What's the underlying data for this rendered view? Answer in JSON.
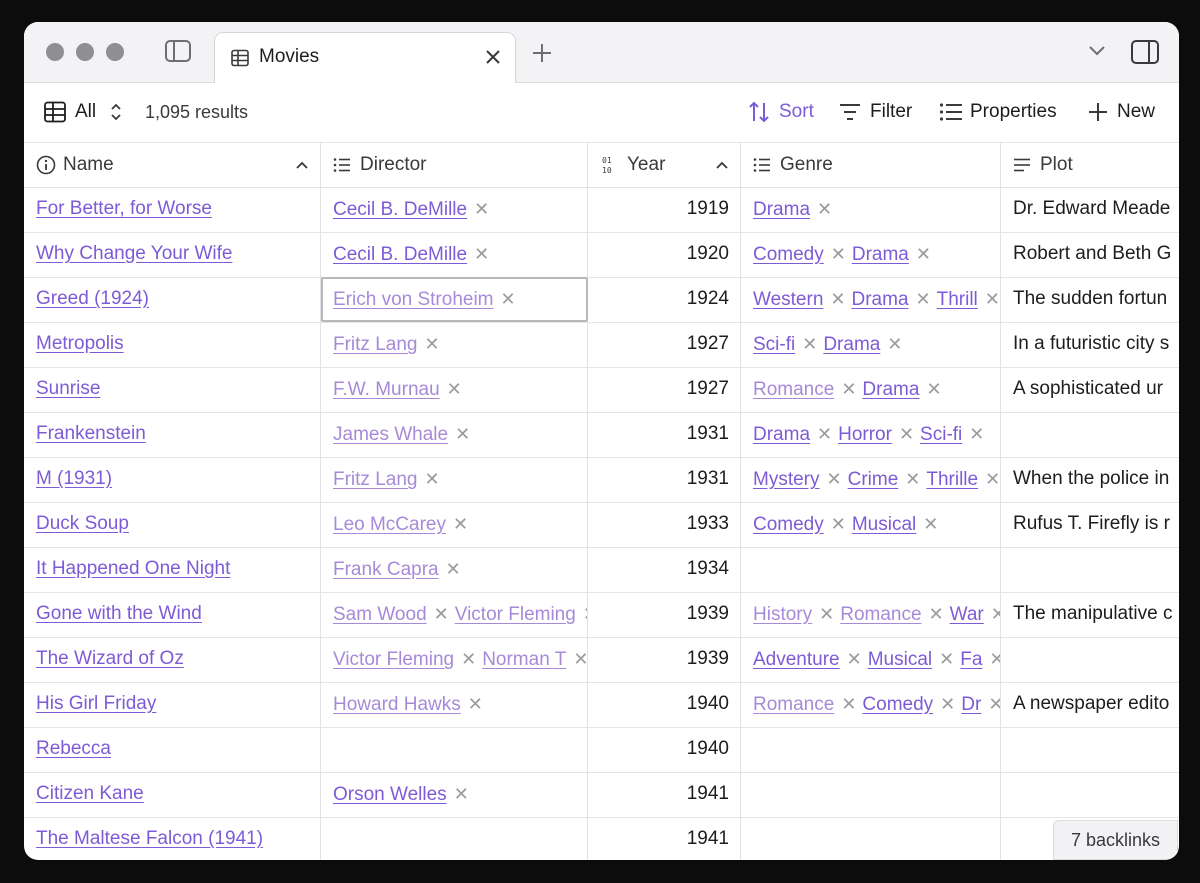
{
  "tab": {
    "title": "Movies"
  },
  "toolbar": {
    "view_label": "All",
    "results": "1,095 results",
    "sort_label": "Sort",
    "filter_label": "Filter",
    "properties_label": "Properties",
    "new_label": "New"
  },
  "columns": {
    "name": "Name",
    "director": "Director",
    "year": "Year",
    "genre": "Genre",
    "plot": "Plot"
  },
  "rows": [
    {
      "name": "For Better, for Worse",
      "directors": [
        {
          "text": "Cecil B. DeMille",
          "style": "link"
        }
      ],
      "year": "1919",
      "genres": [
        {
          "text": "Drama",
          "style": "link"
        }
      ],
      "plot": "Dr. Edward Meade"
    },
    {
      "name": "Why Change Your Wife",
      "directors": [
        {
          "text": "Cecil B. DeMille",
          "style": "link"
        }
      ],
      "year": "1920",
      "genres": [
        {
          "text": "Comedy",
          "style": "link"
        },
        {
          "text": "Drama",
          "style": "link"
        }
      ],
      "plot": "Robert and Beth G"
    },
    {
      "name": "Greed (1924)",
      "directors": [
        {
          "text": "Erich von Stroheim",
          "style": "light"
        }
      ],
      "year": "1924",
      "genres": [
        {
          "text": "Western",
          "style": "link"
        },
        {
          "text": "Drama",
          "style": "link"
        },
        {
          "text": "Thrill",
          "style": "link"
        }
      ],
      "plot": "The sudden fortun"
    },
    {
      "name": "Metropolis",
      "directors": [
        {
          "text": "Fritz Lang",
          "style": "light"
        }
      ],
      "year": "1927",
      "genres": [
        {
          "text": "Sci-fi",
          "style": "link"
        },
        {
          "text": "Drama",
          "style": "link"
        }
      ],
      "plot": "In a futuristic city s"
    },
    {
      "name": "Sunrise",
      "directors": [
        {
          "text": "F.W. Murnau",
          "style": "light"
        }
      ],
      "year": "1927",
      "genres": [
        {
          "text": "Romance",
          "style": "light"
        },
        {
          "text": "Drama",
          "style": "link"
        }
      ],
      "plot": "A sophisticated ur"
    },
    {
      "name": "Frankenstein",
      "directors": [
        {
          "text": "James Whale",
          "style": "light"
        }
      ],
      "year": "1931",
      "genres": [
        {
          "text": "Drama",
          "style": "link"
        },
        {
          "text": "Horror",
          "style": "link"
        },
        {
          "text": "Sci-fi",
          "style": "link"
        }
      ],
      "plot": ""
    },
    {
      "name": "M (1931)",
      "directors": [
        {
          "text": "Fritz Lang",
          "style": "light"
        }
      ],
      "year": "1931",
      "genres": [
        {
          "text": "Mystery",
          "style": "link"
        },
        {
          "text": "Crime",
          "style": "link"
        },
        {
          "text": "Thrille",
          "style": "link"
        }
      ],
      "plot": "When the police in"
    },
    {
      "name": "Duck Soup",
      "directors": [
        {
          "text": "Leo McCarey",
          "style": "light"
        }
      ],
      "year": "1933",
      "genres": [
        {
          "text": "Comedy",
          "style": "link"
        },
        {
          "text": "Musical",
          "style": "link"
        }
      ],
      "plot": "Rufus T. Firefly is r"
    },
    {
      "name": "It Happened One Night",
      "directors": [
        {
          "text": "Frank Capra",
          "style": "light"
        }
      ],
      "year": "1934",
      "genres": [],
      "plot": ""
    },
    {
      "name": "Gone with the Wind",
      "directors": [
        {
          "text": "Sam Wood",
          "style": "light"
        },
        {
          "text": "Victor Fleming",
          "style": "light"
        }
      ],
      "year": "1939",
      "genres": [
        {
          "text": "History",
          "style": "light"
        },
        {
          "text": "Romance",
          "style": "light"
        },
        {
          "text": "War",
          "style": "link"
        }
      ],
      "plot": "The manipulative c"
    },
    {
      "name": "The Wizard of Oz",
      "directors": [
        {
          "text": "Victor Fleming",
          "style": "light"
        },
        {
          "text": "Norman T",
          "style": "light"
        }
      ],
      "year": "1939",
      "genres": [
        {
          "text": "Adventure",
          "style": "link"
        },
        {
          "text": "Musical",
          "style": "link"
        },
        {
          "text": "Fa",
          "style": "link"
        }
      ],
      "plot": ""
    },
    {
      "name": "His Girl Friday",
      "directors": [
        {
          "text": "Howard Hawks",
          "style": "light"
        }
      ],
      "year": "1940",
      "genres": [
        {
          "text": "Romance",
          "style": "light"
        },
        {
          "text": "Comedy",
          "style": "link"
        },
        {
          "text": "Dr",
          "style": "link"
        }
      ],
      "plot": "A newspaper edito"
    },
    {
      "name": "Rebecca",
      "directors": [],
      "year": "1940",
      "genres": [],
      "plot": ""
    },
    {
      "name": "Citizen Kane",
      "directors": [
        {
          "text": "Orson Welles",
          "style": "link"
        }
      ],
      "year": "1941",
      "genres": [],
      "plot": ""
    },
    {
      "name": "The Maltese Falcon (1941)",
      "directors": [],
      "year": "1941",
      "genres": [],
      "plot": ""
    }
  ],
  "footer": {
    "backlinks": "7 backlinks"
  },
  "colors": {
    "accent": "#7d5bd6",
    "accent_light": "#a68ad8"
  },
  "icons": {
    "sidebar_toggle": "sidebar-icon",
    "tab": "table-icon",
    "sort": "sort-arrows-icon",
    "filter": "filter-icon",
    "properties": "list-icon",
    "new": "plus-icon",
    "name_col": "info-circle-icon",
    "director_col": "list-icon",
    "year_col": "number-icon",
    "genre_col": "list-icon",
    "plot_col": "text-lines-icon"
  }
}
